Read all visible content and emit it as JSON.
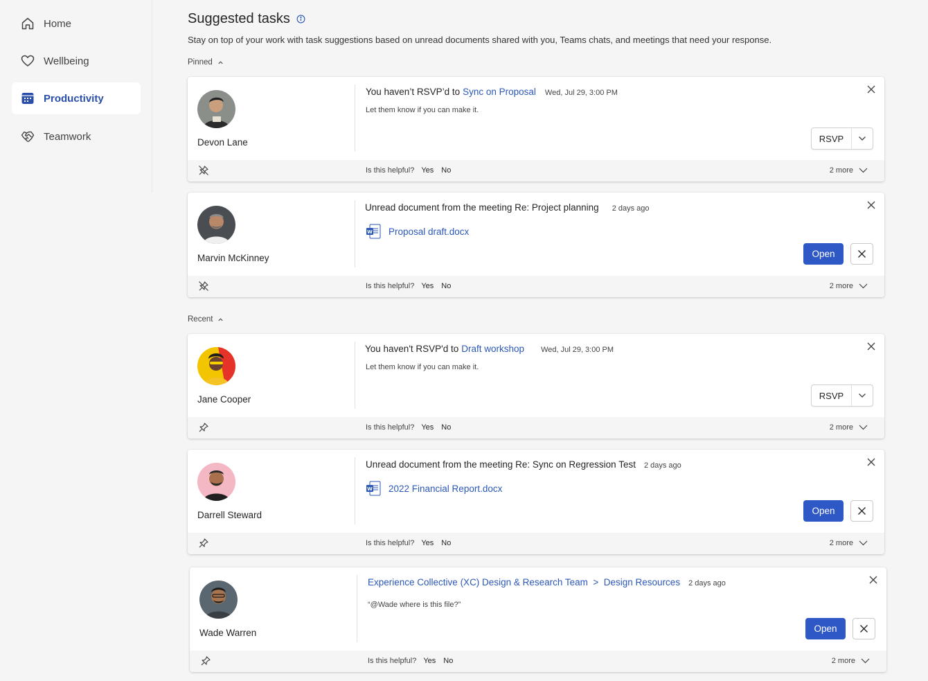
{
  "sidebar": {
    "items": [
      {
        "label": "Home",
        "icon": "home-icon"
      },
      {
        "label": "Wellbeing",
        "icon": "heart-icon"
      },
      {
        "label": "Productivity",
        "icon": "calendar-icon",
        "active": true
      },
      {
        "label": "Teamwork",
        "icon": "handshake-icon"
      }
    ],
    "accent": "#2b4fa8"
  },
  "header": {
    "title": "Suggested tasks",
    "subtitle": "Stay on top of your work with task suggestions based on unread documents shared with you, Teams chats, and meetings that need your response."
  },
  "sections": {
    "pinned": "Pinned",
    "recent": "Recent"
  },
  "footer_text": {
    "question": "Is this helpful?",
    "yes": "Yes",
    "no": "No",
    "more": "2 more"
  },
  "buttons": {
    "rsvp": "RSVP",
    "open": "Open"
  },
  "cards": [
    {
      "person": "Devon Lane",
      "title_prefix": "You haven’t RSVP’d to",
      "title_link": "Sync on Proposal",
      "date": "Wed, Jul 29, 3:00 PM",
      "sub": "Let them know if you can make it.",
      "pin": "unpin-icon"
    },
    {
      "person": "Marvin McKinney",
      "title_prefix": "Unread document from the meeting Re: Project planning",
      "date": "2 days ago",
      "doc": "Proposal draft.docx",
      "pin": "unpin-icon"
    },
    {
      "person": "Jane Cooper",
      "title_prefix": "You haven't RSVP'd to",
      "title_link": "Draft workshop",
      "date": "Wed, Jul 29, 3:00 PM",
      "sub": "Let them know if you can make it.",
      "pin": "pin-icon"
    },
    {
      "person": "Darrell Steward",
      "title_prefix": "Unread document from the meeting Re: Sync on Regression Test",
      "date": "2 days ago",
      "doc": "2022 Financial Report.docx",
      "pin": "pin-icon"
    },
    {
      "person": "Wade Warren",
      "title_link": "Experience Collective (XC) Design & Research Team  >  Design Resources",
      "date": "2 days ago",
      "sub": "“@Wade where is this file?”",
      "pin": "pin-icon"
    }
  ],
  "colors": {
    "primary_button": "#2f58c7",
    "link": "#2b57b8",
    "background": "#f5f5f5"
  }
}
